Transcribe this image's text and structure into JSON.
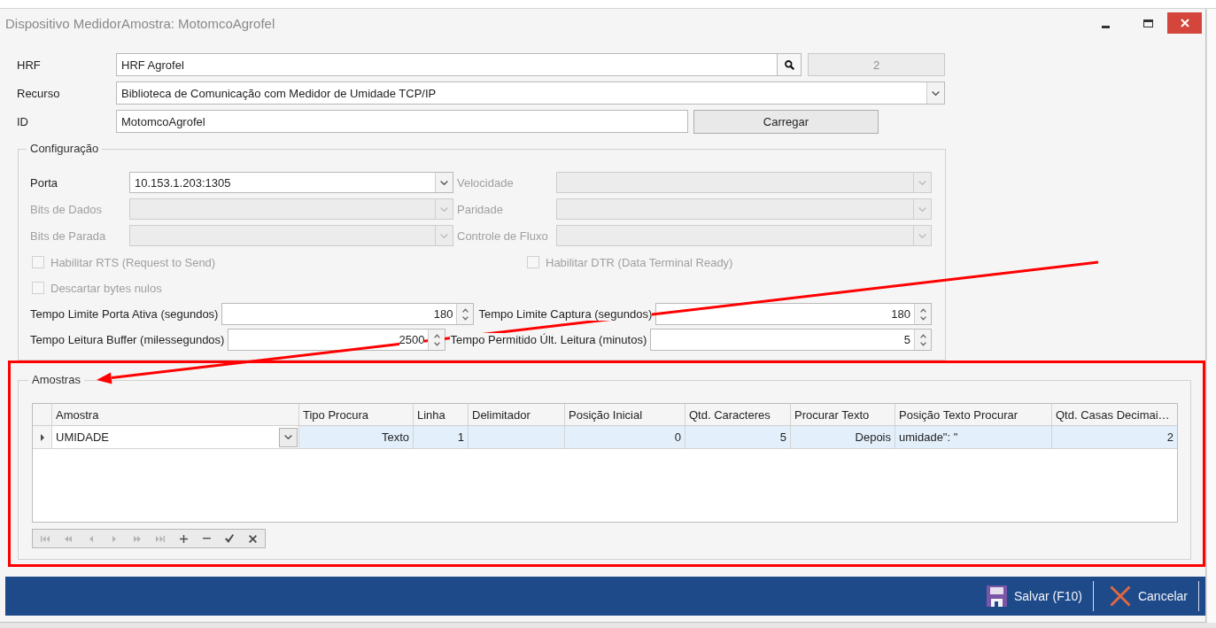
{
  "window": {
    "title": "Dispositivo MedidorAmostra: MotomcoAgrofel"
  },
  "form": {
    "hrf": {
      "label": "HRF",
      "value": "HRF Agrofel",
      "code": "2"
    },
    "recurso": {
      "label": "Recurso",
      "value": "Biblioteca de Comunicação com Medidor de Umidade TCP/IP"
    },
    "id": {
      "label": "ID",
      "value": "MotomcoAgrofel",
      "button": "Carregar"
    }
  },
  "configuracao": {
    "title": "Configuração",
    "combos": [
      {
        "label": "Porta",
        "value": "10.153.1.203:1305",
        "disabled": false
      },
      {
        "label": "Velocidade",
        "disabled": true
      },
      {
        "label": "Bits de Dados",
        "disabled": true
      },
      {
        "label": "Paridade",
        "disabled": true
      },
      {
        "label": "Bits de Parada",
        "disabled": true
      },
      {
        "label": "Controle de Fluxo",
        "disabled": true
      }
    ],
    "checkboxes": [
      {
        "label": "Habilitar RTS (Request to Send)",
        "checked": false,
        "disabled": true
      },
      {
        "label": "Habilitar DTR (Data Terminal Ready)",
        "checked": false,
        "disabled": true
      },
      {
        "label": "Descartar bytes nulos",
        "checked": false,
        "disabled": true
      }
    ],
    "spinners": [
      {
        "label": "Tempo Limite Porta Ativa (segundos)",
        "value": "180"
      },
      {
        "label": "Tempo Limite Captura (segundos)",
        "value": "180"
      },
      {
        "label": "Tempo Leitura Buffer (milessegundos)",
        "value": "2500"
      },
      {
        "label": "Tempo Permitido Últ. Leitura (minutos)",
        "value": "5"
      }
    ]
  },
  "amostras": {
    "title": "Amostras",
    "table": {
      "columns": [
        {
          "label": "Amostra",
          "kind": "lookup"
        },
        {
          "label": "Tipo Procura",
          "kind": "choice"
        },
        {
          "label": "Linha",
          "kind": "number"
        },
        {
          "label": "Delimitador",
          "kind": "text"
        },
        {
          "label": "Posição Inicial",
          "kind": "number"
        },
        {
          "label": "Qtd. Caracteres",
          "kind": "number"
        },
        {
          "label": "Procurar Texto",
          "kind": "choice"
        },
        {
          "label": "Posição Texto Procurar",
          "kind": "text"
        },
        {
          "label": "Qtd. Casas Decimai…",
          "kind": "number"
        }
      ],
      "rows": [
        {
          "selected": true,
          "cells": [
            "UMIDADE",
            "Texto",
            "1",
            null,
            "0",
            "5",
            "Depois",
            "umidade\": \"",
            "2"
          ]
        }
      ]
    },
    "navigator": [
      {
        "kind": "first",
        "disabled": true
      },
      {
        "kind": "prevpage",
        "disabled": true
      },
      {
        "kind": "prev",
        "disabled": true
      },
      {
        "kind": "next",
        "disabled": true
      },
      {
        "kind": "nextpage",
        "disabled": true
      },
      {
        "kind": "last",
        "disabled": true
      },
      {
        "kind": "append",
        "disabled": false
      },
      {
        "kind": "delete",
        "disabled": false
      },
      {
        "kind": "post",
        "disabled": false
      },
      {
        "kind": "cancel",
        "disabled": false
      }
    ]
  },
  "footer": {
    "buttons": [
      {
        "kind": "save",
        "label": "Salvar (F10)"
      },
      {
        "kind": "cancel",
        "label": "Cancelar"
      }
    ]
  }
}
